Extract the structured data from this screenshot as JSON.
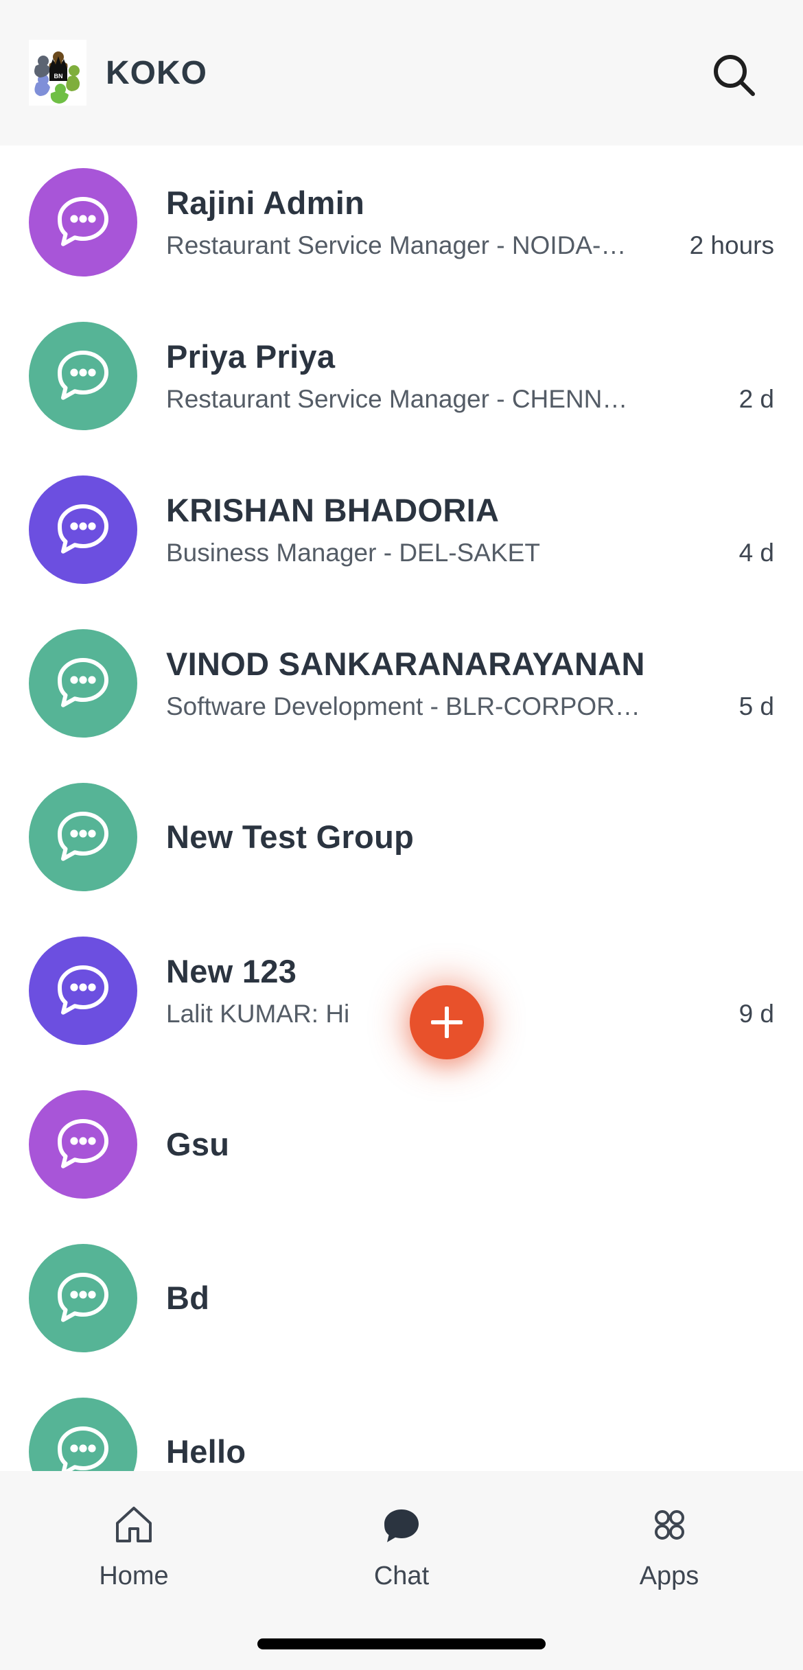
{
  "header": {
    "brand_title": "KOKO",
    "logo_name": "koko-logo",
    "search_icon": "search-icon"
  },
  "colors": {
    "header_bg": "#f7f7f7",
    "page_bg": "#ffffff",
    "avatar_purple_light": "#a855d8",
    "avatar_purple_mid": "#9a4fd6",
    "avatar_indigo": "#6c4fe0",
    "avatar_teal": "#56b496",
    "fab": "#e8512b",
    "title_text": "#2b3440",
    "sub_text": "#545c66",
    "nav_text": "#3e4651"
  },
  "chats": [
    {
      "name": "Rajini Admin",
      "subtitle": "Restaurant Service Manager - NOIDA-…",
      "time": "2 hours",
      "avatar_color": "#a855d8",
      "icon": "chat-bubble-icon"
    },
    {
      "name": "Priya Priya",
      "subtitle": "Restaurant Service Manager - CHENN…",
      "time": "2 d",
      "avatar_color": "#56b496",
      "icon": "chat-bubble-icon"
    },
    {
      "name": "KRISHAN BHADORIA",
      "subtitle": "Business Manager - DEL-SAKET",
      "time": "4 d",
      "avatar_color": "#6c4fe0",
      "icon": "chat-bubble-icon"
    },
    {
      "name": "VINOD SANKARANARAYANAN",
      "subtitle": "Software Development - BLR-CORPOR…",
      "time": "5 d",
      "avatar_color": "#56b496",
      "icon": "chat-bubble-icon"
    },
    {
      "name": "New Test Group",
      "subtitle": "",
      "time": "",
      "avatar_color": "#56b496",
      "icon": "chat-bubble-icon"
    },
    {
      "name": "New 123",
      "subtitle": "Lalit KUMAR: Hi",
      "time": "9 d",
      "avatar_color": "#6c4fe0",
      "icon": "chat-bubble-icon"
    },
    {
      "name": "Gsu",
      "subtitle": "",
      "time": "",
      "avatar_color": "#a855d8",
      "icon": "chat-bubble-icon"
    },
    {
      "name": "Bd",
      "subtitle": "",
      "time": "",
      "avatar_color": "#56b496",
      "icon": "chat-bubble-icon"
    },
    {
      "name": "Hello",
      "subtitle": "",
      "time": "",
      "avatar_color": "#56b496",
      "icon": "chat-bubble-icon"
    }
  ],
  "fab": {
    "label": "+",
    "icon": "plus-icon"
  },
  "bottom_nav": {
    "items": [
      {
        "label": "Home",
        "icon": "home-icon",
        "active": false
      },
      {
        "label": "Chat",
        "icon": "chat-bubble-filled-icon",
        "active": true
      },
      {
        "label": "Apps",
        "icon": "apps-grid-icon",
        "active": false
      }
    ]
  }
}
